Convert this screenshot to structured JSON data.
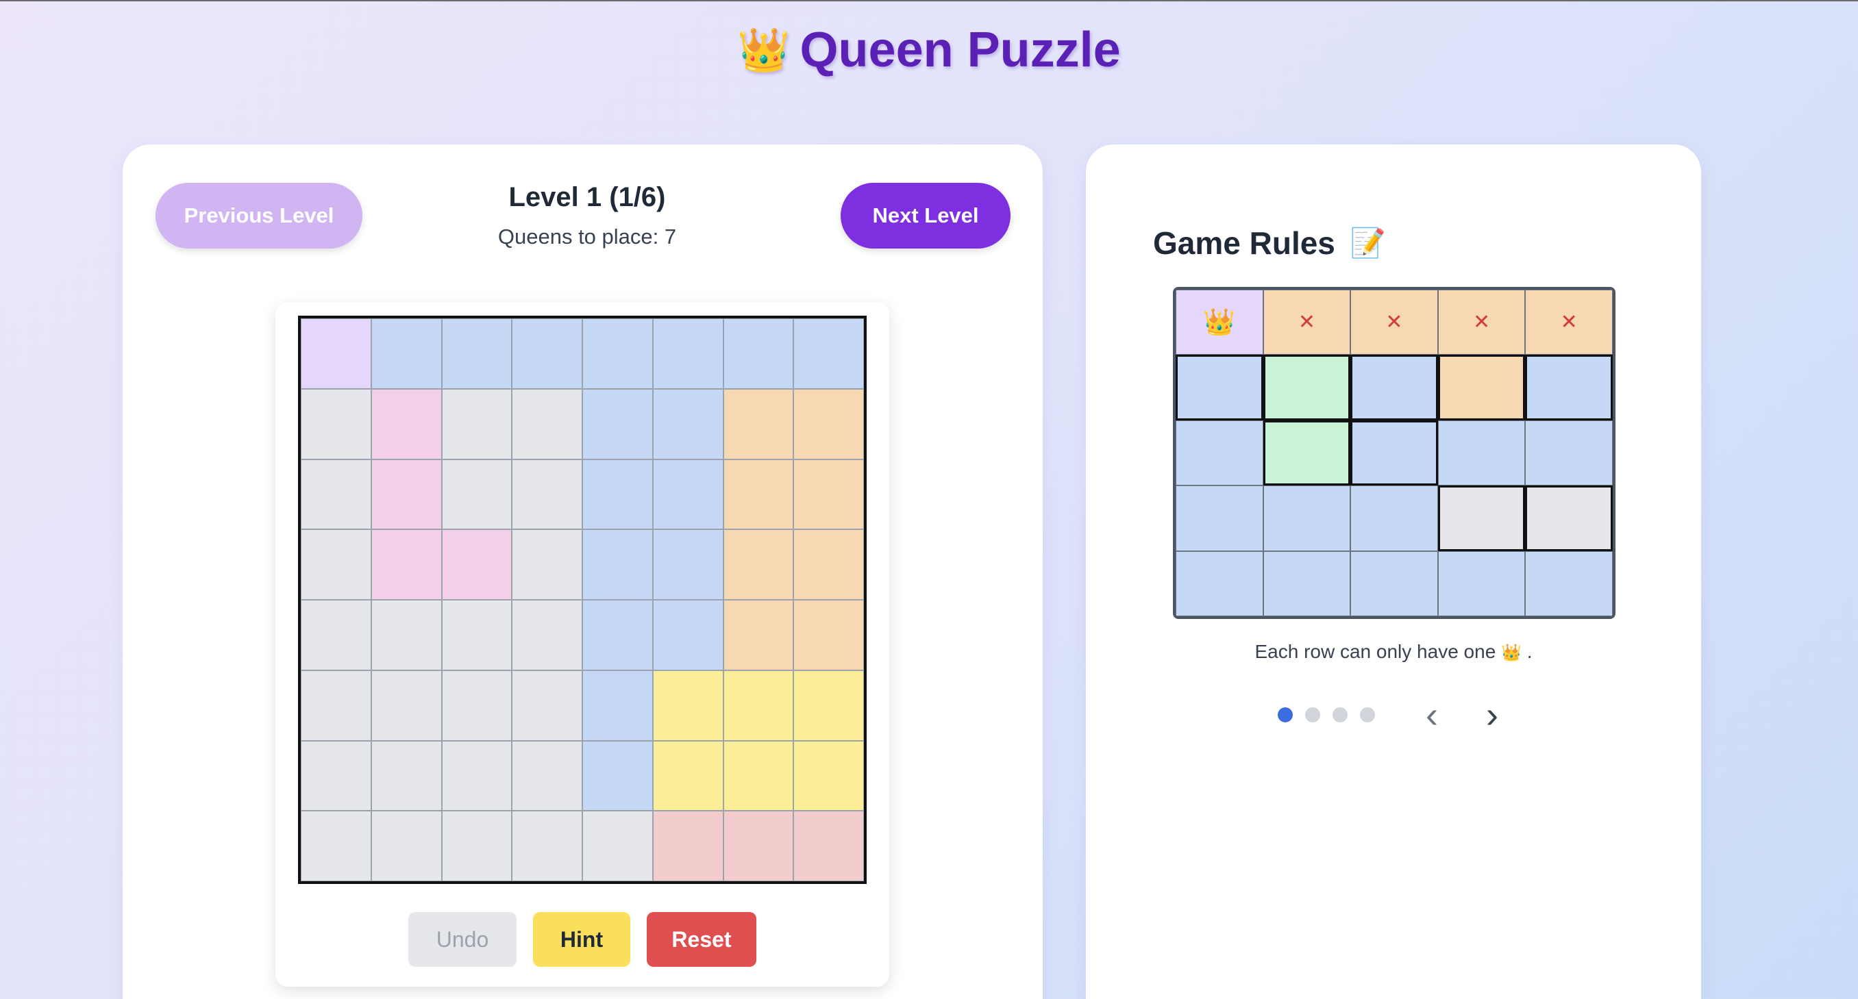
{
  "app": {
    "title": "Queen Puzzle",
    "title_icon": "👑"
  },
  "level": {
    "title": "Level 1 (1/6)",
    "subtitle": "Queens to place: 7",
    "prev_label": "Previous Level",
    "next_label": "Next Level"
  },
  "board": {
    "size": 8,
    "rows": [
      [
        "L",
        "B",
        "B",
        "B",
        "B",
        "B",
        "B",
        "B"
      ],
      [
        "G",
        "P",
        "G",
        "G",
        "B",
        "B",
        "O",
        "O"
      ],
      [
        "G",
        "P",
        "G",
        "G",
        "B",
        "B",
        "O",
        "O"
      ],
      [
        "G",
        "P",
        "P",
        "G",
        "B",
        "B",
        "O",
        "O"
      ],
      [
        "G",
        "G",
        "G",
        "G",
        "B",
        "B",
        "O",
        "O"
      ],
      [
        "G",
        "G",
        "G",
        "G",
        "B",
        "Y",
        "Y",
        "Y"
      ],
      [
        "G",
        "G",
        "G",
        "G",
        "B",
        "Y",
        "Y",
        "Y"
      ],
      [
        "G",
        "G",
        "G",
        "G",
        "G",
        "R",
        "R",
        "R"
      ]
    ],
    "region_colors": {
      "L": "#e5d6fb",
      "B": "#c5d9f7",
      "G": "#e5e7eb",
      "P": "#f1d0e8",
      "O": "#f6d9b3",
      "Y": "#fbee97",
      "R": "#f3cccd"
    }
  },
  "controls": {
    "undo_label": "Undo",
    "hint_label": "Hint",
    "reset_label": "Reset"
  },
  "rules": {
    "title": "Game Rules",
    "title_icon": "📝",
    "example_rows": [
      [
        {
          "c": "L",
          "m": "queen"
        },
        {
          "c": "O",
          "m": "x"
        },
        {
          "c": "O",
          "m": "x"
        },
        {
          "c": "O",
          "m": "x"
        },
        {
          "c": "O",
          "m": "x"
        }
      ],
      [
        {
          "c": "B",
          "b": true
        },
        {
          "c": "Gr",
          "b": true
        },
        {
          "c": "B",
          "b": true
        },
        {
          "c": "O",
          "b": true
        },
        {
          "c": "B",
          "b": true
        }
      ],
      [
        {
          "c": "B"
        },
        {
          "c": "Gr",
          "b": true
        },
        {
          "c": "B",
          "b": true
        },
        {
          "c": "B"
        },
        {
          "c": "B"
        }
      ],
      [
        {
          "c": "B"
        },
        {
          "c": "B"
        },
        {
          "c": "B"
        },
        {
          "c": "G",
          "b": true
        },
        {
          "c": "G",
          "b": true
        }
      ],
      [
        {
          "c": "B"
        },
        {
          "c": "B"
        },
        {
          "c": "B"
        },
        {
          "c": "B"
        },
        {
          "c": "B"
        }
      ]
    ],
    "queen_glyph": "👑",
    "x_glyph": "✕",
    "caption_text": "Each row can only have one",
    "caption_end": ".",
    "slide_count": 4,
    "active_slide": 0,
    "prev_arrow": "‹",
    "next_arrow": "›"
  }
}
